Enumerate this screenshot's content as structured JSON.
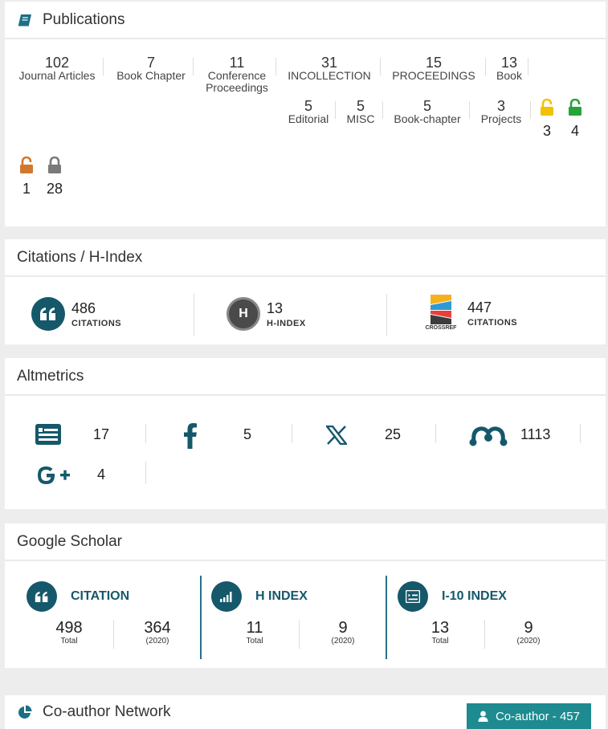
{
  "publications": {
    "title": "Publications",
    "stats": [
      {
        "num": "102",
        "label": "Journal Articles"
      },
      {
        "num": "7",
        "label": "Book Chapter"
      },
      {
        "num": "11",
        "label": "Conference Proceedings"
      },
      {
        "num": "31",
        "label": "INCOLLECTION"
      },
      {
        "num": "15",
        "label": "PROCEEDINGS"
      },
      {
        "num": "13",
        "label": "Book"
      },
      {
        "num": "5",
        "label": "Editorial"
      },
      {
        "num": "5",
        "label": "MISC"
      },
      {
        "num": "5",
        "label": "Book-chapter"
      },
      {
        "num": "3",
        "label": "Projects"
      }
    ],
    "access": [
      {
        "num": "3",
        "icon": "gold-open-lock-icon",
        "color": "#f2c200"
      },
      {
        "num": "4",
        "icon": "green-open-lock-icon",
        "color": "#27a33a"
      },
      {
        "num": "1",
        "icon": "bronze-open-lock-icon",
        "color": "#d0782e"
      },
      {
        "num": "28",
        "icon": "closed-lock-icon",
        "color": "#7a7a7a"
      }
    ]
  },
  "citations": {
    "title": "Citations / H-Index",
    "items": [
      {
        "num": "486",
        "label": "CITATIONS",
        "icon": "quote-icon"
      },
      {
        "num": "13",
        "label": "H-INDEX",
        "icon": "h-index-icon",
        "badge": "H"
      },
      {
        "num": "447",
        "label": "CITATIONS",
        "icon": "crossref-logo",
        "logo_text": "CROSSREF"
      }
    ]
  },
  "altmetrics": {
    "title": "Altmetrics",
    "items": [
      {
        "num": "17",
        "icon": "news-icon"
      },
      {
        "num": "5",
        "icon": "facebook-icon"
      },
      {
        "num": "25",
        "icon": "x-twitter-icon"
      },
      {
        "num": "1113",
        "icon": "mendeley-icon"
      },
      {
        "num": "4",
        "icon": "google-plus-icon"
      }
    ]
  },
  "scholar": {
    "title": "Google Scholar",
    "sections": [
      {
        "title": "CITATION",
        "icon": "quote-icon",
        "total": "498",
        "total_label": "Total",
        "recent": "364",
        "recent_label": "(2020)"
      },
      {
        "title": "H INDEX",
        "icon": "signal-bars-icon",
        "total": "11",
        "total_label": "Total",
        "recent": "9",
        "recent_label": "(2020)"
      },
      {
        "title": "I-10 INDEX",
        "icon": "list-box-icon",
        "total": "13",
        "total_label": "Total",
        "recent": "9",
        "recent_label": "(2020)"
      }
    ]
  },
  "coauthor": {
    "title": "Co-author Network",
    "button": "Co-author - 457"
  }
}
